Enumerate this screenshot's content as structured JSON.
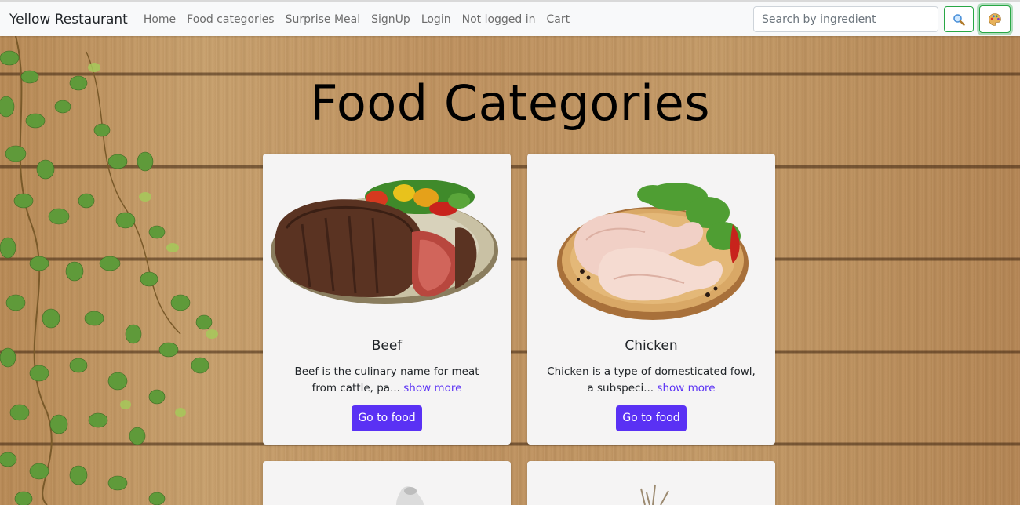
{
  "navbar": {
    "brand": "Yellow Restaurant",
    "links": [
      "Home",
      "Food categories",
      "Surprise Meal",
      "SignUp",
      "Login",
      "Not logged in",
      "Cart"
    ],
    "search_placeholder": "Search by ingredient"
  },
  "page": {
    "title": "Food Categories"
  },
  "categories": [
    {
      "name": "Beef",
      "description": "Beef is the culinary name for meat from cattle, pa...",
      "show_more": "show more",
      "button": "Go to food"
    },
    {
      "name": "Chicken",
      "description": "Chicken is a type of domesticated fowl, a subspeci...",
      "show_more": "show more",
      "button": "Go to food"
    }
  ],
  "colors": {
    "accent": "#5a31f4",
    "button_border": "#28a745",
    "card_bg": "#f5f4f4",
    "navbar_bg": "#f8f9fa"
  },
  "icons": [
    "search-icon",
    "palette-icon"
  ]
}
